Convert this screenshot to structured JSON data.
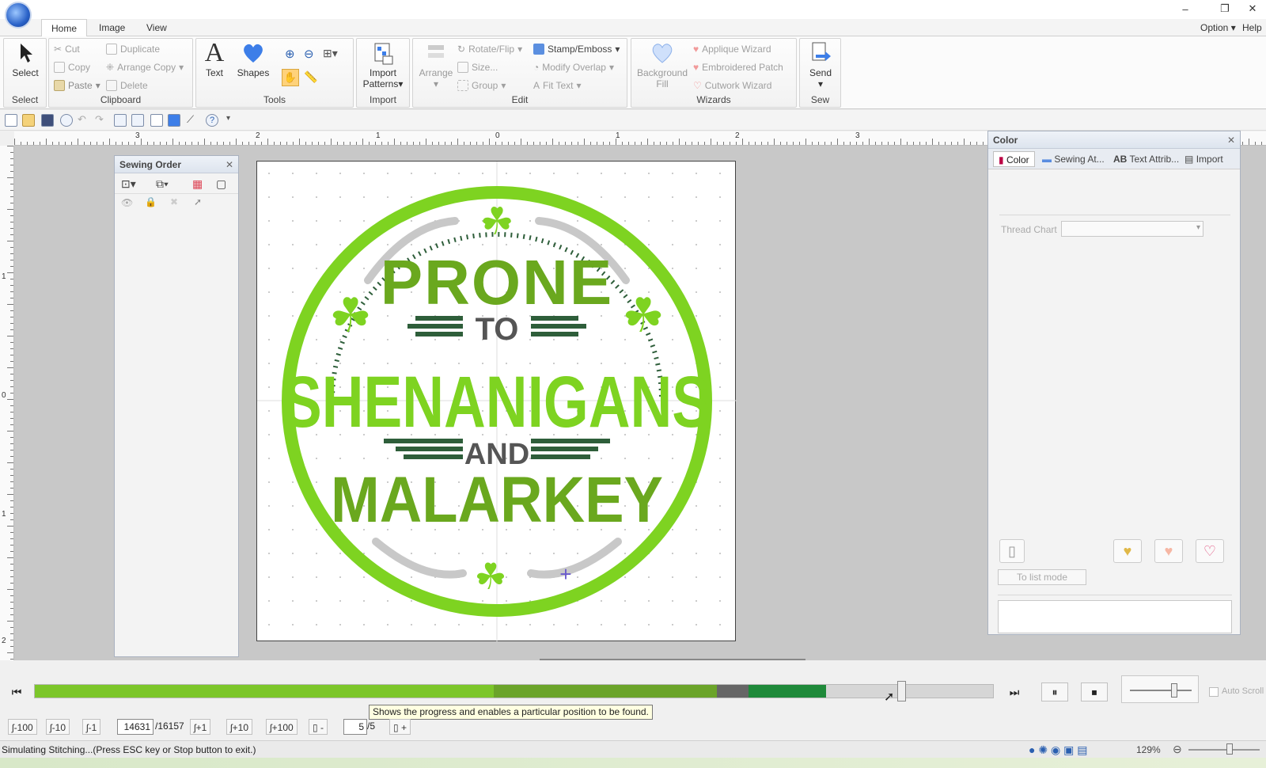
{
  "window": {
    "minimize": "–",
    "restore": "❐",
    "close": "✕"
  },
  "tabs": [
    "Home",
    "Image",
    "View"
  ],
  "menu_right": {
    "option": "Option",
    "help": "Help"
  },
  "ribbon": {
    "select": {
      "label": "Select",
      "group": "Select"
    },
    "clipboard": {
      "group": "Clipboard",
      "cut": "Cut",
      "copy": "Copy",
      "paste": "Paste",
      "duplicate": "Duplicate",
      "arrange_copy": "Arrange Copy",
      "delete": "Delete"
    },
    "tools": {
      "group": "Tools",
      "text": "Text",
      "shapes": "Shapes"
    },
    "import": {
      "group": "Import",
      "patterns_line1": "Import",
      "patterns_line2": "Patterns"
    },
    "edit": {
      "group": "Edit",
      "arrange": "Arrange",
      "rotate_flip": "Rotate/Flip",
      "size": "Size...",
      "group_btn": "Group",
      "stamp_emboss": "Stamp/Emboss",
      "modify_overlap": "Modify Overlap",
      "fit_text": "Fit Text"
    },
    "wizards": {
      "group": "Wizards",
      "background_line1": "Background",
      "background_line2": "Fill",
      "applique": "Applique Wizard",
      "embroidered_patch": "Embroidered Patch",
      "cutwork": "Cutwork Wizard"
    },
    "sew": {
      "group": "Sew",
      "send": "Send"
    }
  },
  "ruler": {
    "h_labels": [
      "3",
      "2",
      "1",
      "0",
      "1",
      "2",
      "3"
    ],
    "v_labels": [
      "1",
      "0",
      "1",
      "2"
    ]
  },
  "sewing_order": {
    "title": "Sewing Order"
  },
  "color_panel": {
    "title": "Color",
    "tabs": [
      "Color",
      "Sewing At...",
      "Text Attrib...",
      "Import"
    ],
    "thread_chart_label": "Thread Chart",
    "to_list_mode": "To list mode"
  },
  "design": {
    "line1": "PRONE",
    "line2": "TO",
    "line3": "SHENANIGANS",
    "line4": "AND",
    "line5": "MALARKEY",
    "colors": {
      "bright": "#7ed321",
      "mid": "#6aa81e",
      "dark": "#2e5e3a",
      "gray": "#555555",
      "silver": "#c8c8c8"
    }
  },
  "simulator": {
    "progress_fraction": 0.905,
    "segments": [
      {
        "color": "#7cc62a",
        "start": 0,
        "end": 0.479
      },
      {
        "color": "#6ba42a",
        "start": 0.479,
        "end": 0.712
      },
      {
        "color": "#666666",
        "start": 0.712,
        "end": 0.745
      },
      {
        "color": "#1f8a3a",
        "start": 0.745,
        "end": 0.826
      }
    ],
    "tooltip": "Shows the progress and enables a particular position to be found.",
    "auto_scroll": "Auto Scroll",
    "steps": {
      "m100": "-100",
      "m10": "-10",
      "m1": "-1",
      "p1": "+1",
      "p10": "+10",
      "p100": "+100"
    },
    "stitch_current": "14631",
    "stitch_total": "/16157",
    "color_minus": "-",
    "color_plus": "+",
    "color_current": "5",
    "color_total": "/5"
  },
  "status": {
    "text": "Simulating Stitching...(Press ESC key or Stop button to exit.)",
    "zoom": "129%"
  }
}
